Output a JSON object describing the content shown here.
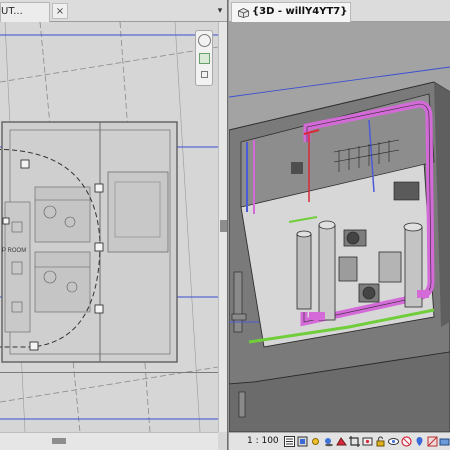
{
  "left_view": {
    "tab_label": "UT...",
    "close_glyph": "×",
    "more_glyph": "▾",
    "room_label": "P ROOM",
    "icons": [
      "close-icon",
      "chevron-down-icon",
      "navigation-wheel-icon"
    ]
  },
  "right_view": {
    "tab_label": "{3D - willY4YT7}",
    "tab_icon": "3d-view-icon",
    "status": {
      "scale": "1 : 100",
      "icons": [
        "detail-level-icon",
        "visual-style-icon",
        "sun-path-icon",
        "shadows-icon",
        "rendering-icon",
        "crop-view-icon",
        "show-crop-icon",
        "unlock-3d-icon",
        "temporary-hide-icon",
        "reveal-hidden-icon",
        "worksharing-icon",
        "analytical-model-icon",
        "highlight-displacement-icon"
      ]
    }
  },
  "colors": {
    "pipe_green": "#6fce3a",
    "pipe_magenta": "#d36ad8",
    "gridline_blue": "#3a4fd0"
  }
}
